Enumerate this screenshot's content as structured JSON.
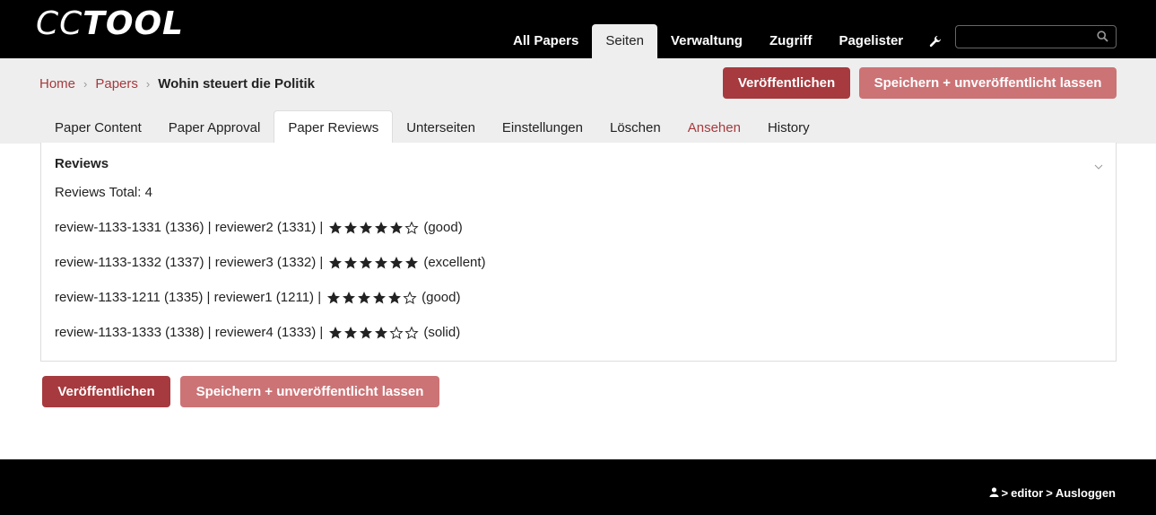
{
  "app": {
    "logo_left": "CC",
    "logo_right": "TOOL"
  },
  "nav": {
    "items": [
      {
        "label": "All Papers",
        "active": false
      },
      {
        "label": "Seiten",
        "active": true
      },
      {
        "label": "Verwaltung",
        "active": false
      },
      {
        "label": "Zugriff",
        "active": false
      },
      {
        "label": "Pagelister",
        "active": false
      }
    ],
    "settings_icon": "wrench-icon",
    "search": {
      "placeholder": "",
      "value": "",
      "icon": "search-icon"
    }
  },
  "breadcrumb": {
    "home": "Home",
    "papers": "Papers",
    "current": "Wohin steuert die Politik"
  },
  "actions": {
    "publish": "Veröffentlichen",
    "save_unpublished": "Speichern + unveröffentlicht lassen"
  },
  "tabs": [
    {
      "label": "Paper Content",
      "active": false,
      "link": false
    },
    {
      "label": "Paper Approval",
      "active": false,
      "link": false
    },
    {
      "label": "Paper Reviews",
      "active": true,
      "link": false
    },
    {
      "label": "Unterseiten",
      "active": false,
      "link": false
    },
    {
      "label": "Einstellungen",
      "active": false,
      "link": false
    },
    {
      "label": "Löschen",
      "active": false,
      "link": false
    },
    {
      "label": "Ansehen",
      "active": false,
      "link": true
    },
    {
      "label": "History",
      "active": false,
      "link": false
    }
  ],
  "panel": {
    "title": "Reviews",
    "total": "Reviews Total: 4",
    "reviews": [
      {
        "text": "review-1133-1331 (1336) | reviewer2 (1331) |",
        "rating": 5,
        "filled": 5,
        "label": "(good)",
        "total_stars": 6
      },
      {
        "text": "review-1133-1332 (1337) | reviewer3 (1332) |",
        "rating": 6,
        "filled": 6,
        "label": "(excellent)",
        "total_stars": 6
      },
      {
        "text": "review-1133-1211 (1335) | reviewer1 (1211) |",
        "rating": 5,
        "filled": 5,
        "label": "(good)",
        "total_stars": 6
      },
      {
        "text": "review-1133-1333 (1338) | reviewer4 (1333) |",
        "rating": 4,
        "filled": 4,
        "label": "(solid)",
        "total_stars": 6
      }
    ]
  },
  "footer": {
    "user_icon": "user-icon",
    "username": "editor",
    "logout": "Ausloggen",
    "separator": ">"
  },
  "colors": {
    "accent": "#a63a3e",
    "accent_light": "#cc7376",
    "topbar": "#000000",
    "band": "#eeeeee"
  }
}
